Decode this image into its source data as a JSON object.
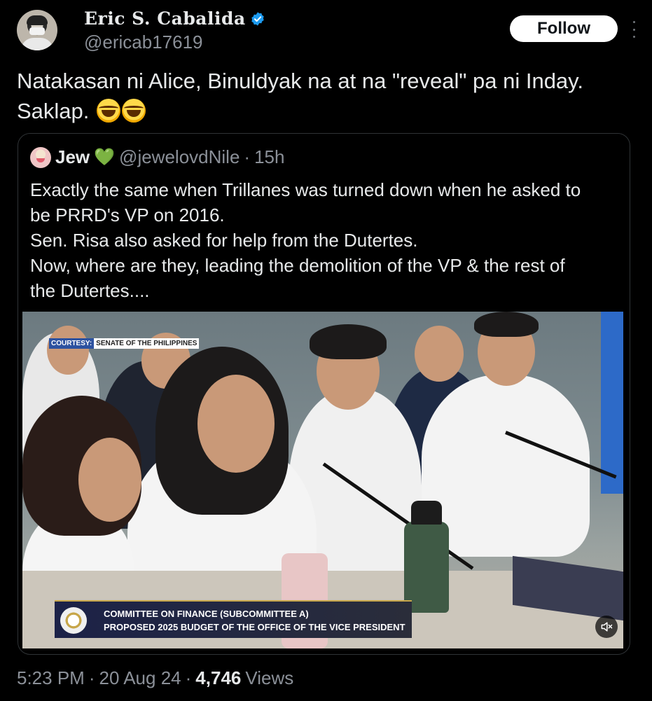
{
  "author": {
    "display_name": "Eric S. Cabalida",
    "handle": "@ericab17619",
    "verified_icon": "verified-badge-icon",
    "avatar_icon": "avatar"
  },
  "actions": {
    "follow_label": "Follow",
    "more_icon": "more-vertical-icon"
  },
  "tweet": {
    "text": "Natakasan ni Alice, Binuldyak na at na \"reveal\" pa ni Inday. Saklap.",
    "emoji_icon": "tears-of-joy-emoji"
  },
  "quote": {
    "display_name": "Jew",
    "heart_emoji": "💚",
    "handle": "@jewelovdNile",
    "separator": "·",
    "time": "15h",
    "lines": [
      "Exactly the same when Trillanes was turned down when he asked to",
      "be PRRD's VP on 2016.",
      "Sen. Risa also asked for help from the Dutertes.",
      "Now, where are they, leading the demolition of the VP & the rest of",
      "the Dutertes...."
    ],
    "media": {
      "courtesy_label": "COURTESY:",
      "courtesy_source": "SENATE OF THE PHILIPPINES",
      "lower_third_line1": "COMMITTEE ON FINANCE (SUBCOMMITTEE A)",
      "lower_third_line2": "PROPOSED 2025 BUDGET OF THE OFFICE OF THE VICE PRESIDENT",
      "mute_icon": "volume-muted-icon"
    }
  },
  "footer": {
    "time": "5:23 PM",
    "sep1": "·",
    "date": "20 Aug 24",
    "sep2": "·",
    "views_count": "4,746",
    "views_label": "Views"
  },
  "colors": {
    "background": "#000000",
    "text": "#e7e9ea",
    "muted": "#8b9098",
    "verified": "#1d9bf0"
  }
}
